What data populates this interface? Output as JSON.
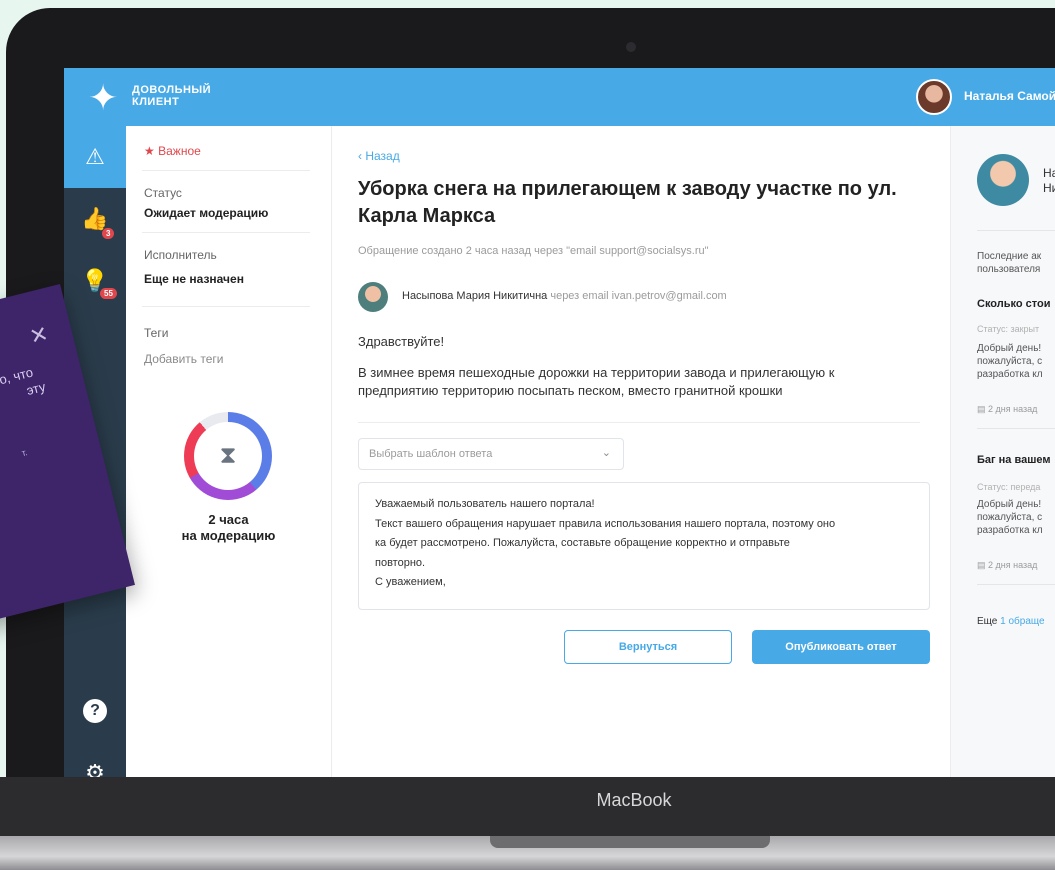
{
  "app": {
    "logo_line1": "ДОВОЛЬНЫЙ",
    "logo_line2": "КЛИЕНТ",
    "user_name": "Наталья Самой"
  },
  "nav": {
    "badges": {
      "likes": "3",
      "ideas": "55"
    },
    "icons": [
      "warning-icon",
      "thumbs-up-icon",
      "lightbulb-icon",
      "help-icon",
      "gear-icon",
      "chart-icon"
    ]
  },
  "details": {
    "important": "Важное",
    "status_label": "Статус",
    "status_value": "Ожидает модерацию",
    "assignee_label": "Исполнитель",
    "assignee_value": "Еще не назначен",
    "tags_label": "Теги",
    "tags_add": "Добавить теги",
    "timer_value": "2 часа",
    "timer_caption": "на модерацию"
  },
  "ticket": {
    "back": "Назад",
    "title": "Уборка снега на прилегающем к заводу участке по ул. Карла Маркса",
    "subtitle": "Обращение создано 2 часа назад через \"email support@socialsys.ru\"",
    "author_name": "Насыпова Мария Никитична",
    "author_via": "через email ivan.petrov@gmail.com",
    "greeting": "Здравствуйте!",
    "body": "В зимнее время пешеходные дорожки на территории завода и прилегающую к предприятию территорию посыпать песком, вместо гранитной крошки",
    "template_placeholder": "Выбрать шаблон ответа",
    "reply_lines": [
      "Уважаемый пользователь нашего портала!",
      "Текст вашего обращения нарушает правила использования нашего портала, поэтому оно",
      "ка будет рассмотрено. Пожалуйста, составьте обращение корректно и отправьте",
      "повторно.",
      "С уважением,"
    ],
    "btn_back": "Вернуться",
    "btn_publish": "Опубликовать ответ"
  },
  "sidebar_right": {
    "name_line1": "На",
    "name_line2": "Ни",
    "recent_line1": "Последние ак",
    "recent_line2": "пользователя",
    "item1_title": "Сколько стои",
    "item1_status": "Статус: закрыт",
    "item1_line1": "Добрый день!",
    "item1_line2": "пожалуйста, с",
    "item1_line3": "разработка кл",
    "item1_date": "2 дня назад",
    "item2_title": "Баг на вашем",
    "item2_status": "Статус: переда",
    "item2_line1": "Добрый день!",
    "item2_line2": "пожалуйста, с",
    "item2_line3": "разработка кл",
    "item2_date": "2 дня назад",
    "more_prefix": "Еще",
    "more_link": "1 обраще"
  },
  "card": {
    "line1": "о, что",
    "line2": "эту",
    "line3": "т."
  },
  "device": {
    "label": "MacBook"
  }
}
